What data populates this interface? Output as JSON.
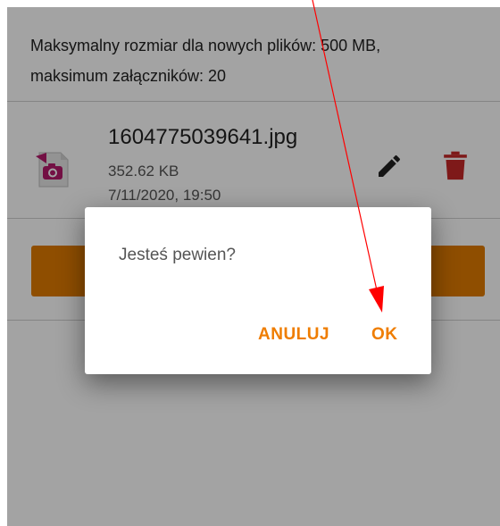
{
  "info": {
    "line1": "Maksymalny rozmiar dla nowych plików: 500 MB,",
    "line2": "maksimum załączników: 20"
  },
  "file": {
    "name": "1604775039641.jpg",
    "size": "352.62 KB",
    "date": "7/11/2020, 19:50",
    "icon": "image-file-icon"
  },
  "dialog": {
    "message": "Jesteś pewien?",
    "cancel_label": "ANULUJ",
    "ok_label": "OK"
  },
  "colors": {
    "accent": "#ef7d00",
    "button": "#e07b00",
    "delete": "#c62828",
    "annotation": "#ff0000"
  }
}
